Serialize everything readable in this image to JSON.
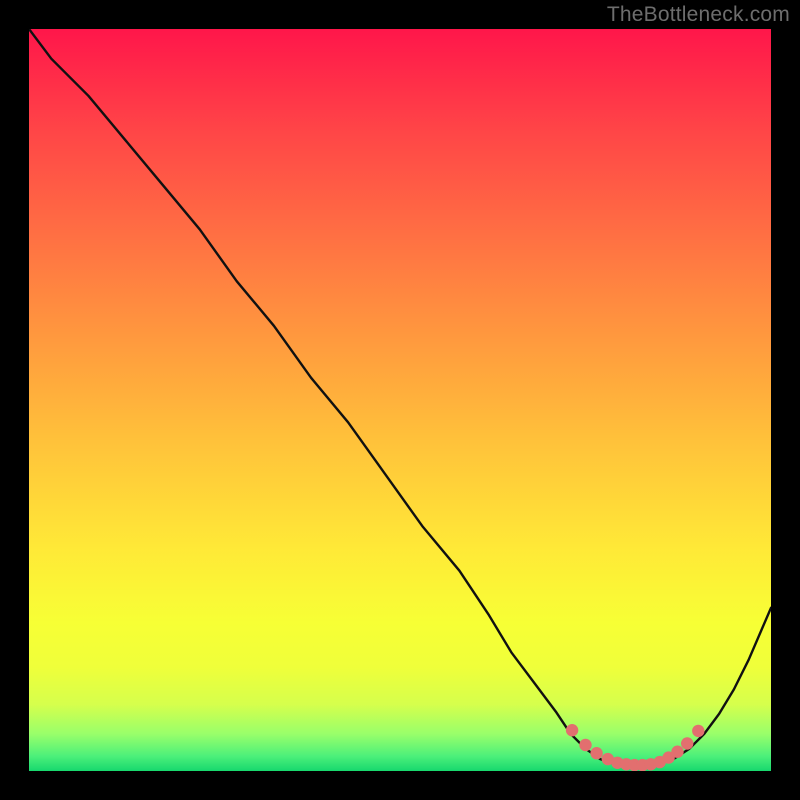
{
  "watermark": "TheBottleneck.com",
  "chart_data": {
    "type": "line",
    "title": "",
    "xlabel": "",
    "ylabel": "",
    "xlim": [
      0,
      100
    ],
    "ylim": [
      0,
      100
    ],
    "series": [
      {
        "name": "main-curve",
        "x": [
          0,
          3,
          8,
          13,
          18,
          23,
          28,
          33,
          38,
          43,
          48,
          53,
          58,
          62,
          65,
          68,
          71,
          73,
          75,
          77,
          79,
          81,
          83,
          85,
          87,
          89,
          91,
          93,
          95,
          97,
          100
        ],
        "y": [
          100,
          96,
          91,
          85,
          79,
          73,
          66,
          60,
          53,
          47,
          40,
          33,
          27,
          21,
          16,
          12,
          8,
          5,
          3,
          1.6,
          0.9,
          0.7,
          0.7,
          1.0,
          1.7,
          3.0,
          5.0,
          7.7,
          11,
          15,
          22
        ]
      }
    ],
    "flat_region": {
      "name": "bottom-dots",
      "x": [
        73.2,
        75.0,
        76.5,
        78.0,
        79.3,
        80.5,
        81.6,
        82.7,
        83.8,
        85.0,
        86.2,
        87.4,
        88.7,
        90.2
      ],
      "y": [
        5.5,
        3.5,
        2.4,
        1.6,
        1.1,
        0.9,
        0.8,
        0.8,
        0.9,
        1.2,
        1.8,
        2.6,
        3.7,
        5.4
      ]
    },
    "colors": {
      "curve": "#111111",
      "dots": "#e26f6f"
    }
  }
}
